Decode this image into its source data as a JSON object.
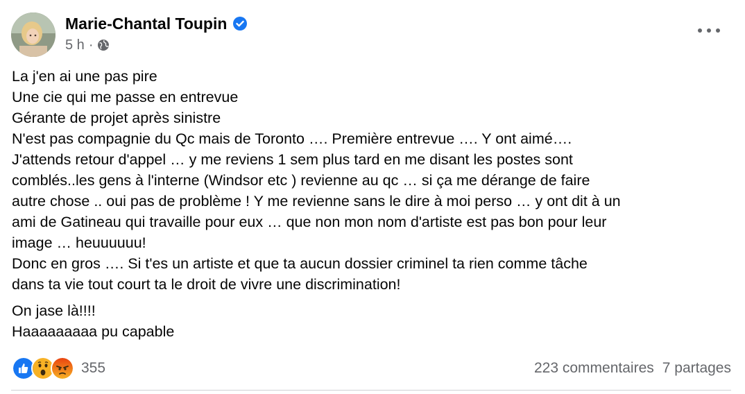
{
  "post": {
    "author": "Marie-Chantal Toupin",
    "timestamp": "5 h",
    "separator": "·",
    "paragraphs": [
      "La j'en ai une pas pire\nUne cie qui me passe en entrevue\nGérante de projet après sinistre\nN'est pas compagnie du Qc mais de Toronto …. Première entrevue …. Y ont aimé….\nJ'attends retour d'appel … y me reviens 1 sem plus tard en me disant les postes sont\ncomblés..les gens à l'interne (Windsor etc ) revienne au qc … si ça me dérange de faire\nautre chose .. oui pas de problème ! Y me revienne sans le dire à moi perso … y ont dit à un\nami de Gatineau qui travaille pour eux … que non mon nom d'artiste est pas bon pour leur\nimage … heuuuuuu!\nDonc en gros …. Si t'es un artiste et que ta aucun dossier criminel ta rien comme tâche\ndans ta vie tout court ta le droit de vivre une discrimination!",
      "On jase là!!!!\nHaaaaaaaaa pu capable"
    ]
  },
  "footer": {
    "reaction_icons": [
      "like-icon",
      "wow-icon",
      "angry-icon"
    ],
    "reaction_count": "355",
    "comments": "223 commentaires",
    "shares": "7 partages"
  },
  "colors": {
    "accent": "#1877f2",
    "secondary_text": "#65676b",
    "primary_text": "#050505",
    "divider": "#ced0d4"
  }
}
